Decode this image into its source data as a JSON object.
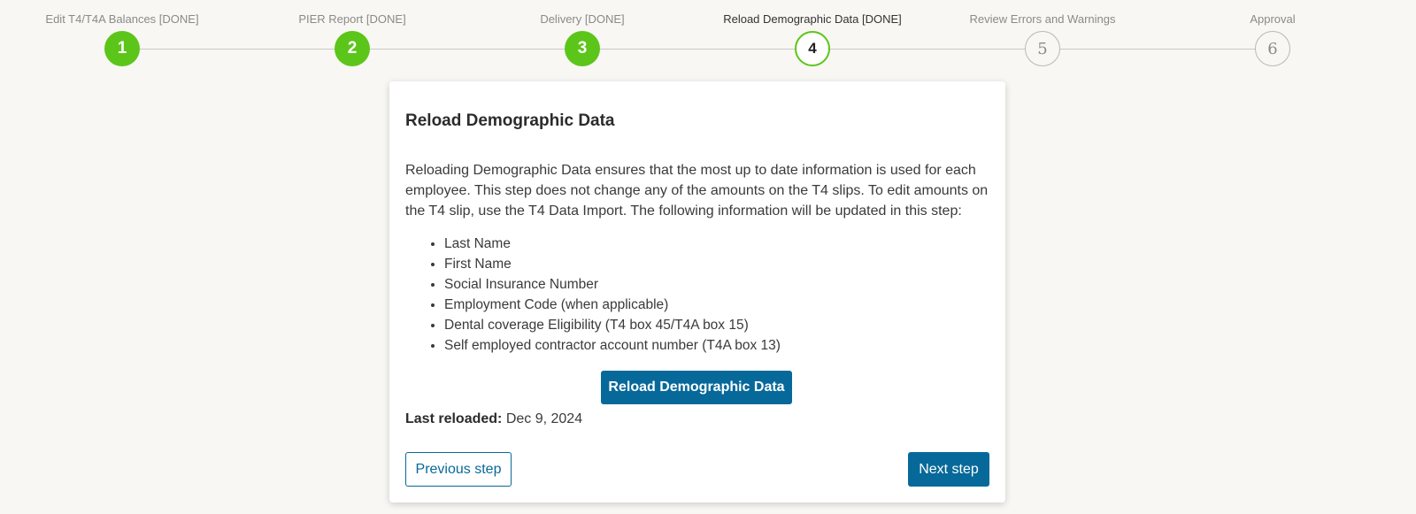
{
  "stepper": {
    "steps": [
      {
        "number": "1",
        "label": "Edit T4/T4A Balances [DONE]",
        "state": "done"
      },
      {
        "number": "2",
        "label": "PIER Report [DONE]",
        "state": "done"
      },
      {
        "number": "3",
        "label": "Delivery [DONE]",
        "state": "done"
      },
      {
        "number": "4",
        "label": "Reload Demographic Data [DONE]",
        "state": "active"
      },
      {
        "number": "5",
        "label": "Review Errors and Warnings",
        "state": "pending"
      },
      {
        "number": "6",
        "label": "Approval",
        "state": "pending"
      }
    ]
  },
  "card": {
    "title": "Reload Demographic Data",
    "description": "Reloading Demographic Data ensures that the most up to date information is used for each employee. This step does not change any of the amounts on the T4 slips. To edit amounts on the T4 slip, use the T4 Data Import. The following information will be updated in this step:",
    "items": [
      "Last Name",
      "First Name",
      "Social Insurance Number",
      "Employment Code (when applicable)",
      "Dental coverage Eligibility (T4 box 45/T4A box 15)",
      "Self employed contractor account number (T4A box 13)"
    ],
    "reload_button": "Reload Demographic Data",
    "last_reloaded_label": "Last reloaded:",
    "last_reloaded_value": "Dec 9, 2024",
    "previous_button": "Previous step",
    "next_button": "Next step"
  },
  "colors": {
    "done": "#5cc51a",
    "primary": "#07699a",
    "background": "#f8f7f3"
  }
}
